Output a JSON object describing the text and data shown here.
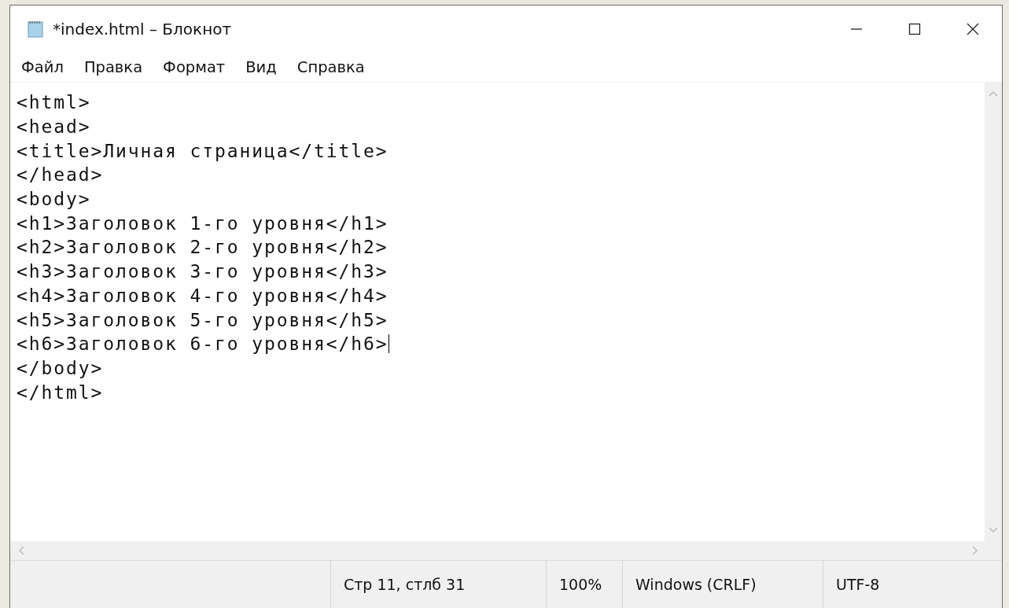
{
  "window": {
    "title": "*index.html – Блокнот"
  },
  "menu": [
    {
      "label": "Файл"
    },
    {
      "label": "Правка"
    },
    {
      "label": "Формат"
    },
    {
      "label": "Вид"
    },
    {
      "label": "Справка"
    }
  ],
  "editor": {
    "lines": [
      {
        "text": "<html>",
        "caret": false
      },
      {
        "text": "<head>",
        "caret": false
      },
      {
        "text": "<title>Личная страница</title>",
        "caret": false
      },
      {
        "text": "</head>",
        "caret": false
      },
      {
        "text": "<body>",
        "caret": false
      },
      {
        "text": "<h1>Заголовок 1-го уровня</h1>",
        "caret": false
      },
      {
        "text": "<h2>Заголовок 2-го уровня</h2>",
        "caret": false
      },
      {
        "text": "<h3>Заголовок 3-го уровня</h3>",
        "caret": false
      },
      {
        "text": "<h4>Заголовок 4-го уровня</h4>",
        "caret": false
      },
      {
        "text": "<h5>Заголовок 5-го уровня</h5>",
        "caret": false
      },
      {
        "text": "<h6>Заголовок 6-го уровня</h6>",
        "caret": true
      },
      {
        "text": "</body>",
        "caret": false
      },
      {
        "text": "</html>",
        "caret": false
      }
    ]
  },
  "status_bar": {
    "position": "Стр 11, стлб 31",
    "zoom": "100%",
    "line_ending": "Windows (CRLF)",
    "encoding": "UTF-8"
  }
}
